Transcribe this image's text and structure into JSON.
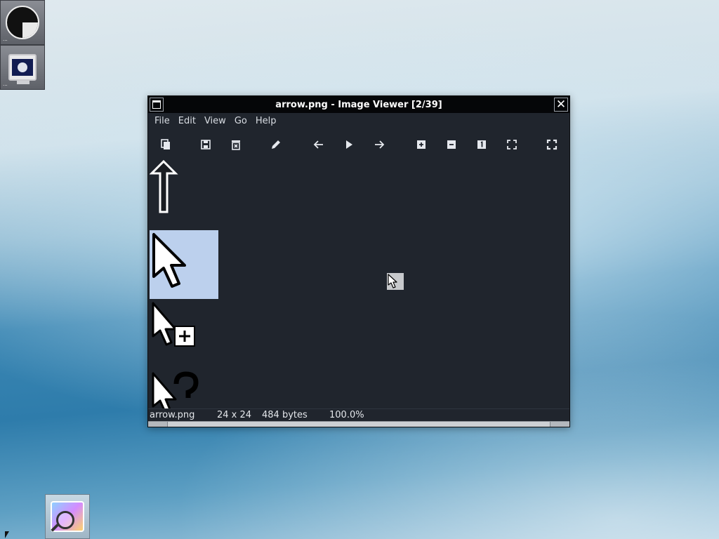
{
  "window": {
    "title": "arrow.png - Image Viewer [2/39]"
  },
  "menu": [
    "File",
    "Edit",
    "View",
    "Go",
    "Help"
  ],
  "toolbar": {
    "items": [
      {
        "name": "open-icon"
      },
      {
        "name": "save-icon"
      },
      {
        "name": "delete-icon"
      },
      {
        "name": "edit-icon"
      },
      {
        "name": "previous-arrow-icon"
      },
      {
        "name": "slideshow-play-icon"
      },
      {
        "name": "next-arrow-icon"
      },
      {
        "name": "zoom-in-icon"
      },
      {
        "name": "zoom-out-icon"
      },
      {
        "name": "zoom-100-icon"
      },
      {
        "name": "zoom-fit-icon"
      },
      {
        "name": "fullscreen-icon"
      }
    ]
  },
  "thumbnails": [
    {
      "name": "up-arrow-cursor",
      "selected": false
    },
    {
      "name": "arrow-cursor",
      "selected": true
    },
    {
      "name": "copy-cursor",
      "selected": false
    },
    {
      "name": "help-cursor",
      "selected": false
    }
  ],
  "status": {
    "filename": "arrow.png",
    "dimensions": "24 x 24",
    "size": "484 bytes",
    "zoom": "100.0%"
  },
  "colors": {
    "titlebar": "#050608",
    "window_bg": "#20252d",
    "selection": "#bcd0ed",
    "text": "#e4e7eb"
  }
}
